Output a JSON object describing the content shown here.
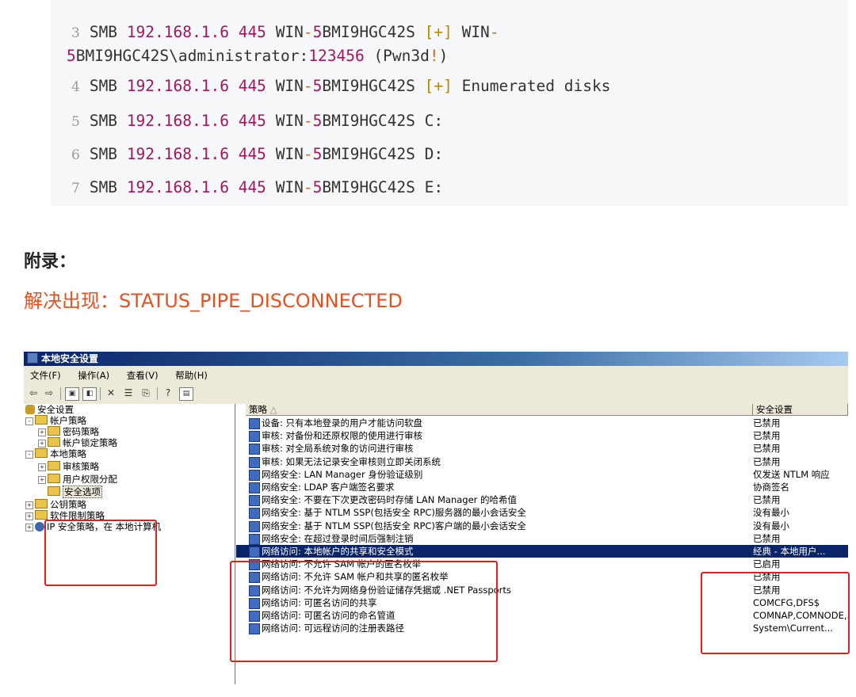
{
  "code": {
    "lines": [
      {
        "n": "3",
        "parts": [
          "SMB ",
          "192.168.1.6",
          " ",
          "445",
          " WIN",
          "-",
          "5",
          "BMI9HGC42S ",
          "[",
          "+",
          "]",
          " WIN",
          "-"
        ],
        "line2": [
          "5",
          "BMI9HGC42S\\administrator:",
          "123456",
          " (Pwn3d",
          "!",
          ")"
        ]
      },
      {
        "n": "4",
        "text_suffix": "Enumerated disks"
      },
      {
        "n": "5",
        "text_suffix": "C:"
      },
      {
        "n": "6",
        "text_suffix": "D:"
      },
      {
        "n": "7",
        "text_suffix": "E:"
      }
    ],
    "smb": "SMB",
    "ip": "192.168.1.6",
    "port": "445",
    "host_prefix": "WIN",
    "host_dash": "-",
    "host_num": "5",
    "host_rest": "BMI9HGC42S",
    "plus_open": "[",
    "plus": "+",
    "plus_close": "]",
    "line3_tail": "WIN",
    "line3b_path": "BMI9HGC42S\\administrator:",
    "line3b_pass": "123456",
    "line3b_pwn": " (Pwn3d",
    "line3b_bang": "!",
    "line3b_close": ")"
  },
  "appendix_title": "附录：",
  "solution_title": "解决出现：STATUS_PIPE_DISCONNECTED",
  "window": {
    "title": "本地安全设置",
    "menu": [
      "文件(F)",
      "操作(A)",
      "查看(V)",
      "帮助(H)"
    ],
    "tree": [
      {
        "label": "安全设置",
        "level": 0,
        "icon": "gear"
      },
      {
        "label": "帐户策略",
        "level": 1,
        "icon": "folder",
        "exp": "-"
      },
      {
        "label": "密码策略",
        "level": 2,
        "icon": "folder",
        "exp": "+"
      },
      {
        "label": "帐户锁定策略",
        "level": 2,
        "icon": "folder",
        "exp": "+"
      },
      {
        "label": "本地策略",
        "level": 1,
        "icon": "folder",
        "exp": "-"
      },
      {
        "label": "审核策略",
        "level": 2,
        "icon": "folder",
        "exp": "+"
      },
      {
        "label": "用户权限分配",
        "level": 2,
        "icon": "folder",
        "exp": "+"
      },
      {
        "label": "安全选项",
        "level": 2,
        "icon": "folder",
        "exp": "",
        "selected": true
      },
      {
        "label": "公钥策略",
        "level": 1,
        "icon": "folder",
        "exp": "+"
      },
      {
        "label": "软件限制策略",
        "level": 1,
        "icon": "folder",
        "exp": "+"
      },
      {
        "label": "IP 安全策略，在 本地计算机",
        "level": 1,
        "icon": "ipsec",
        "exp": "+"
      }
    ],
    "col_policy": "策略",
    "col_sort": "△",
    "col_setting": "安全设置",
    "rows": [
      {
        "policy": "设备: 只有本地登录的用户才能访问软盘",
        "setting": "已禁用"
      },
      {
        "policy": "审核: 对备份和还原权限的使用进行审核",
        "setting": "已禁用"
      },
      {
        "policy": "审核: 对全局系统对象的访问进行审核",
        "setting": "已禁用"
      },
      {
        "policy": "审核: 如果无法记录安全审核则立即关闭系统",
        "setting": "已禁用"
      },
      {
        "policy": "网络安全: LAN Manager 身份验证级别",
        "setting": "仅发送 NTLM 响应"
      },
      {
        "policy": "网络安全: LDAP 客户端签名要求",
        "setting": "协商签名"
      },
      {
        "policy": "网络安全: 不要在下次更改密码时存储 LAN Manager 的哈希值",
        "setting": "已禁用"
      },
      {
        "policy": "网络安全: 基于 NTLM SSP(包括安全 RPC)服务器的最小会话安全",
        "setting": "没有最小"
      },
      {
        "policy": "网络安全: 基于 NTLM SSP(包括安全 RPC)客户端的最小会话安全",
        "setting": "没有最小"
      },
      {
        "policy": "网络安全: 在超过登录时间后强制注销",
        "setting": "已禁用"
      },
      {
        "policy": "网络访问: 本地帐户的共享和安全模式",
        "setting": "经典 - 本地用户...",
        "highlight": true
      },
      {
        "policy": "网络访问: 不允许 SAM 帐户的匿名枚举",
        "setting": "已启用"
      },
      {
        "policy": "网络访问: 不允许 SAM 帐户和共享的匿名枚举",
        "setting": "已禁用"
      },
      {
        "policy": "网络访问: 不允许为网络身份验证储存凭据或 .NET Passports",
        "setting": "已禁用"
      },
      {
        "policy": "网络访问: 可匿名访问的共享",
        "setting": "COMCFG,DFS$"
      },
      {
        "policy": "网络访问: 可匿名访问的命名管道",
        "setting": "COMNAP,COMNODE,..."
      },
      {
        "policy": "网络访问: 可远程访问的注册表路径",
        "setting": "System\\Current..."
      }
    ]
  }
}
